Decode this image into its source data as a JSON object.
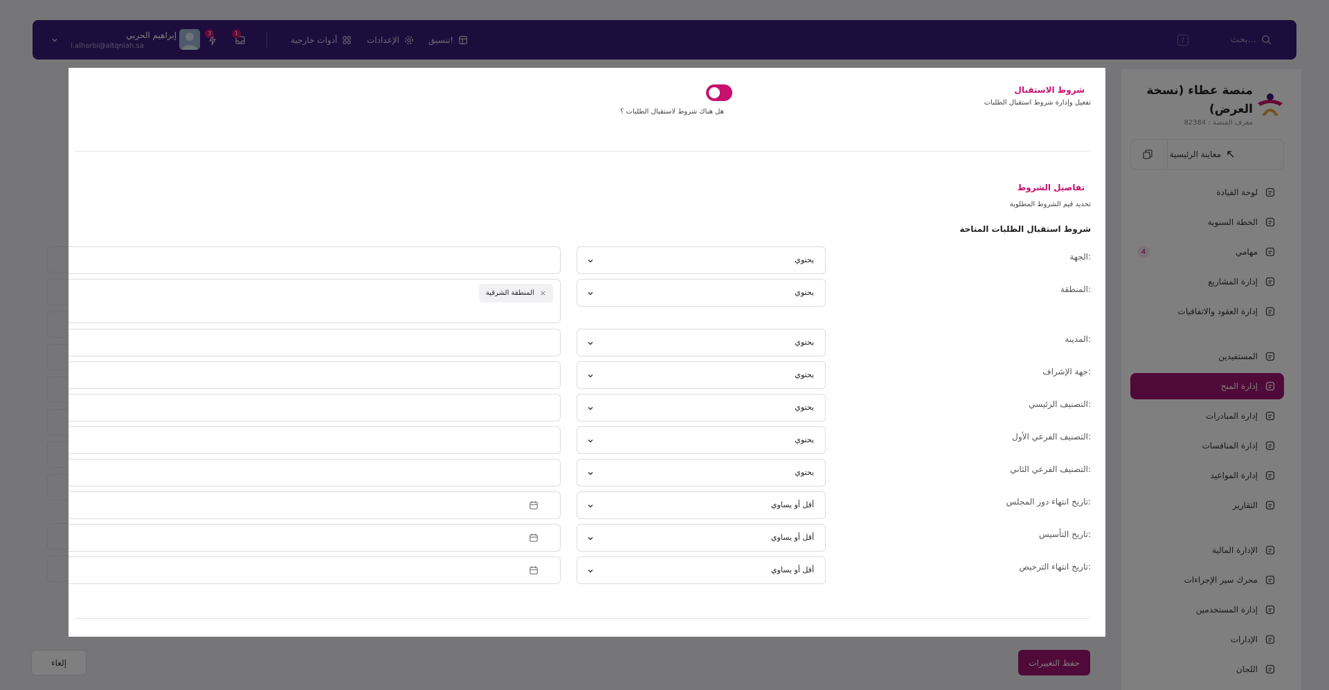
{
  "topbar": {
    "search_placeholder": "بحث...",
    "search_shortcut": "/",
    "coordinate_label": "تنسيق!",
    "settings_label": "الإعدادات",
    "external_tools_label": "أدوات خارجية",
    "notifications_count": "1",
    "lightning_count": "3",
    "user_name": "إبراهيم الحربي",
    "user_email": "i.alharbi@altqniah.sa"
  },
  "sidebar": {
    "platform_title": "منصة عطاء (نسخة العرض)",
    "platform_id": "معرف المنصة : 82384",
    "preview_label": "معاينة الرئيسية",
    "items": [
      {
        "label": "لوحة القيادة",
        "icon": "home-icon"
      },
      {
        "label": "الخطة السنوية",
        "icon": "bulb-icon"
      },
      {
        "label": "مهامي",
        "icon": "tasks-icon",
        "count": "4"
      },
      {
        "label": "إدارة المشاريع",
        "icon": "briefcase-icon"
      },
      {
        "label": "إدارة العقود والاتفاقيات",
        "icon": "clipboard-icon"
      },
      {
        "label": "المستفيدين",
        "icon": "user-icon"
      },
      {
        "label": "إدارة المنح",
        "icon": "hand-icon",
        "active": true
      },
      {
        "label": "إدارة المبادرات",
        "icon": "flag-icon"
      },
      {
        "label": "إدارة المنافسات",
        "icon": "crown-icon"
      },
      {
        "label": "إدارة المواعيد",
        "icon": "calendar-icon"
      },
      {
        "label": "التقارير",
        "icon": "report-icon"
      },
      {
        "label": "الإدارة المالية",
        "icon": "finance-icon"
      },
      {
        "label": "محرك سير الإجراءات",
        "icon": "workflow-icon"
      },
      {
        "label": "إدارة المستخدمين",
        "icon": "users-icon"
      },
      {
        "label": "الإدارات",
        "icon": "building-icon"
      },
      {
        "label": "اللجان",
        "icon": "grid-icon"
      }
    ]
  },
  "footer": {
    "save_label": "حفظ التغييرات",
    "cancel_label": "إلغاء"
  },
  "modal": {
    "reception": {
      "title": "شروط الاستقبال",
      "subtitle": "تفعيل وإدارة شروط استقبال الطلبات",
      "toggle_question": "هل هناك شروط لاستقبال الطلبات ؟",
      "toggle_on": true
    },
    "details": {
      "title": "تفاصيل الشروط",
      "subtitle": "تحديد قيم الشروط المطلوبة",
      "available_title": "شروط استقبال الطلبات المتاحة"
    },
    "conditions": [
      {
        "label": "الجهة:",
        "operator": "يحتوي",
        "value": "",
        "type": "text"
      },
      {
        "label": "المنطقة:",
        "operator": "يحتوي",
        "value": "",
        "type": "tags",
        "tags": [
          "المنطقة الشرقية"
        ]
      },
      {
        "label": "المدينة:",
        "operator": "يحتوي",
        "value": "",
        "type": "text"
      },
      {
        "label": "جهة الإشراف:",
        "operator": "يحتوي",
        "value": "",
        "type": "text"
      },
      {
        "label": "التصنيف الرئيسي:",
        "operator": "يحتوي",
        "value": "",
        "type": "text"
      },
      {
        "label": "التصنيف الفرعي الأول:",
        "operator": "يحتوي",
        "value": "",
        "type": "text"
      },
      {
        "label": "التصنيف الفرعي الثاني:",
        "operator": "يحتوي",
        "value": "",
        "type": "text"
      },
      {
        "label": "تاريخ انتهاء دور المجلس:",
        "operator": "أقل أو يساوي",
        "value": "",
        "type": "date"
      },
      {
        "label": "تاريخ التأسيس:",
        "operator": "أقل أو يساوي",
        "value": "",
        "type": "date"
      },
      {
        "label": "تاريخ انتهاء الترخيص:",
        "operator": "أقل أو يساوي",
        "value": "",
        "type": "date"
      }
    ]
  },
  "colors": {
    "topbar_bg": "#3b1a78",
    "accent": "#c8106e",
    "active_nav": "#a01473"
  }
}
